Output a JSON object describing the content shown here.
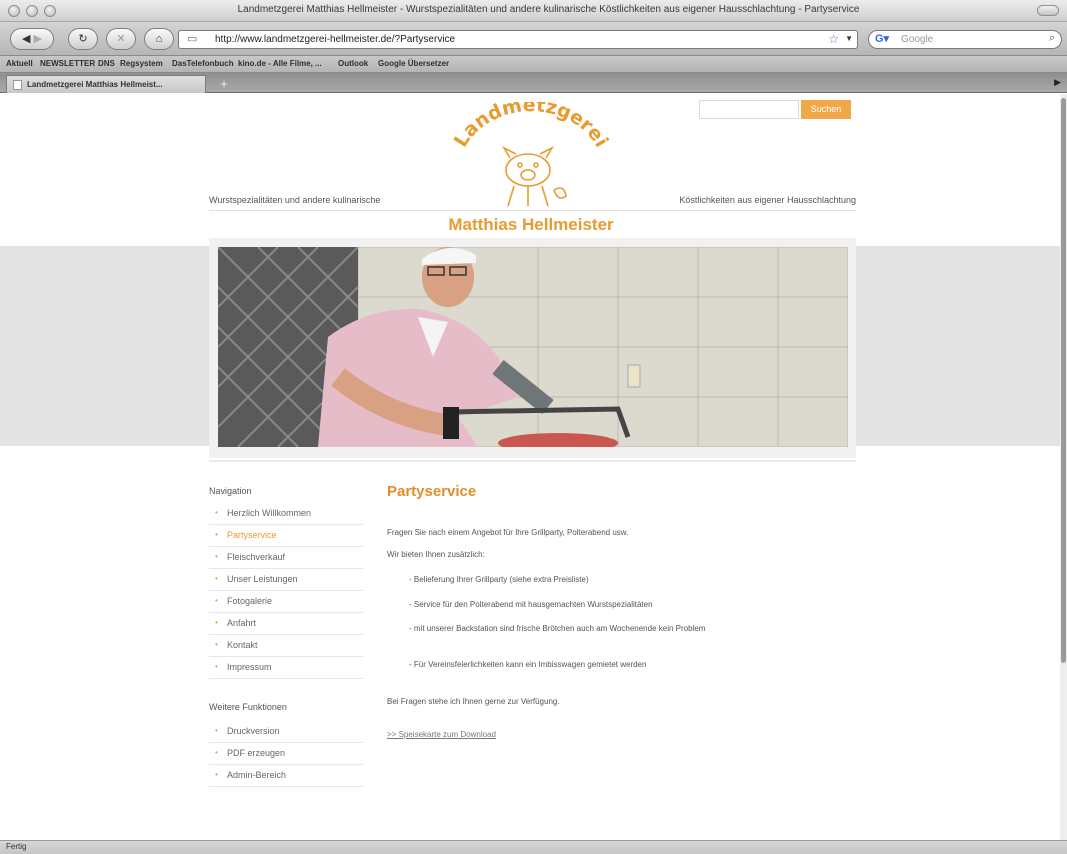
{
  "window": {
    "title": "Landmetzgerei Matthias Hellmeister - Wurstspezialitäten und andere kulinarische Köstlichkeiten aus eigener Hausschlachtung - Partyservice"
  },
  "toolbar": {
    "url": "http://www.landmetzgerei-hellmeister.de/?Partyservice",
    "search_placeholder": "Google"
  },
  "bookmarks": [
    "Aktuell",
    "NEWSLETTER",
    "DNS",
    "Regsystem",
    "DasTelefonbuch",
    "kino.de - Alle Filme, ...",
    "Outlook",
    "Google Übersetzer"
  ],
  "tab": {
    "label": "Landmetzgerei Matthias Hellmeist..."
  },
  "site": {
    "search_button": "Suchen",
    "logo_text": "Landmetzgerei",
    "name": "Matthias Hellmeister",
    "tagline_left": "Wurstspezialitäten und andere kulinarische",
    "tagline_right": "Köstlichkeiten aus eigener Hausschlachtung"
  },
  "navigation": {
    "heading": "Navigation",
    "items": [
      {
        "label": "Herzlich Willkommen",
        "active": false
      },
      {
        "label": "Partyservice",
        "active": true
      },
      {
        "label": "Fleischverkauf",
        "active": false
      },
      {
        "label": "Unser Leistungen",
        "active": false
      },
      {
        "label": "Fotogalerie",
        "active": false
      },
      {
        "label": "Anfahrt",
        "active": false
      },
      {
        "label": "Kontakt",
        "active": false
      },
      {
        "label": "Impressum",
        "active": false
      }
    ]
  },
  "functions": {
    "heading": "Weitere Funktionen",
    "items": [
      {
        "label": "Druckversion"
      },
      {
        "label": "PDF erzeugen"
      },
      {
        "label": "Admin-Bereich"
      }
    ]
  },
  "main": {
    "title": "Partyservice",
    "intro": "Fragen Sie nach einem Angebot für Ihre Grillparty, Polterabend usw.",
    "offer_intro": "Wir bieten Ihnen zusätzlich:",
    "list": [
      "- Belieferung Ihrer Grillparty (siehe extra Preisliste)",
      "- Service für den Polterabend mit hausgemachten Wurstspezialitäten",
      "- mit unserer Backstation sind frische Brötchen auch am Wochenende kein Problem",
      "- Für Vereinsfeierlichkeiten kann ein Imbisswagen gemietet werden"
    ],
    "closing": "Bei Fragen stehe ich Ihnen gerne zur Verfügung.",
    "download_link": ">> Speisekarte zum Download"
  },
  "status": {
    "text": "Fertig"
  },
  "colors": {
    "accent": "#e99a30",
    "band": "#e3e3e3"
  }
}
